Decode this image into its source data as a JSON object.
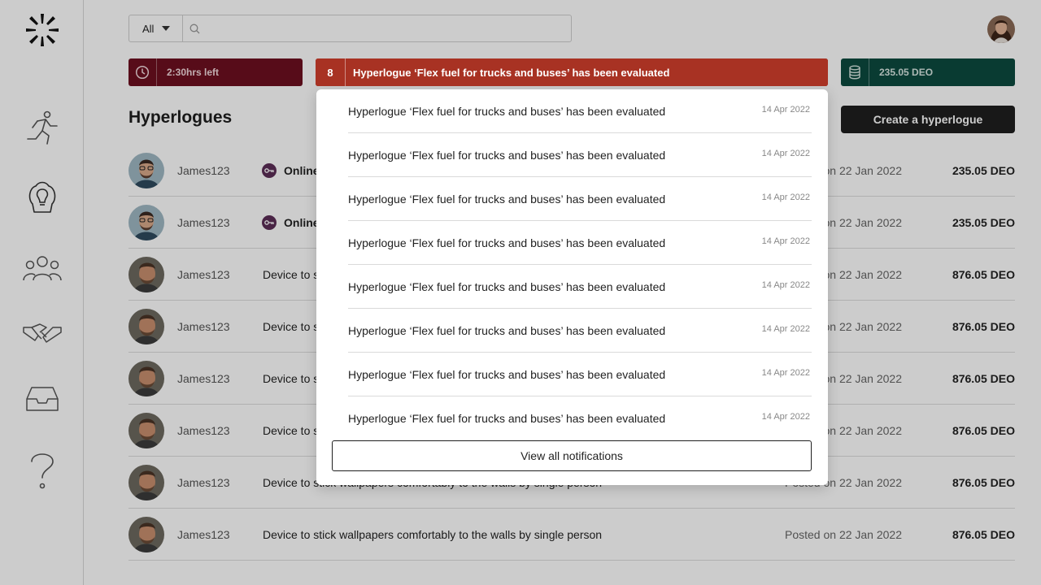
{
  "search": {
    "filter_value": "All",
    "placeholder": ""
  },
  "timer": {
    "label": "2:30hrs left"
  },
  "notification_bar": {
    "count": "8",
    "text": "Hyperlogue ‘Flex fuel for trucks and buses’ has been evaluated"
  },
  "balance": {
    "label": "235.05 DEO"
  },
  "page": {
    "title": "Hyperlogues",
    "create_button": "Create a hyperlogue"
  },
  "rows": [
    {
      "user": "James123",
      "title": "Online",
      "date": "Posted on 22 Jan 2022",
      "price": "235.05 DEO",
      "status_icon": "key-icon"
    },
    {
      "user": "James123",
      "title": "Online",
      "date": "Posted on 22 Jan 2022",
      "price": "235.05 DEO",
      "status_icon": "key-icon"
    },
    {
      "user": "James123",
      "title": "Device to stick wallpapers comfortably to the walls by single person",
      "date": "Posted on 22 Jan 2022",
      "price": "876.05 DEO"
    },
    {
      "user": "James123",
      "title": "Device to stick wallpapers comfortably to the walls by single person",
      "date": "Posted on 22 Jan 2022",
      "price": "876.05 DEO"
    },
    {
      "user": "James123",
      "title": "Device to stick wallpapers comfortably to the walls by single person",
      "date": "Posted on 22 Jan 2022",
      "price": "876.05 DEO"
    },
    {
      "user": "James123",
      "title": "Device to stick wallpapers comfortably to the walls by single person",
      "date": "Posted on 22 Jan 2022",
      "price": "876.05 DEO"
    },
    {
      "user": "James123",
      "title": "Device to stick wallpapers comfortably to the walls by single person",
      "date": "Posted on 22 Jan 2022",
      "price": "876.05 DEO"
    },
    {
      "user": "James123",
      "title": "Device to stick wallpapers comfortably to the walls by single person",
      "date": "Posted on 22 Jan 2022",
      "price": "876.05 DEO"
    }
  ],
  "notifications": [
    {
      "text": "Hyperlogue ‘Flex fuel for trucks and buses’ has been evaluated",
      "date": "14 Apr 2022"
    },
    {
      "text": "Hyperlogue ‘Flex fuel for trucks and buses’ has been evaluated",
      "date": "14 Apr 2022"
    },
    {
      "text": "Hyperlogue ‘Flex fuel for trucks and buses’ has been evaluated",
      "date": "14 Apr 2022"
    },
    {
      "text": "Hyperlogue ‘Flex fuel for trucks and buses’ has been evaluated",
      "date": "14 Apr 2022"
    },
    {
      "text": "Hyperlogue ‘Flex fuel for trucks and buses’ has been evaluated",
      "date": "14 Apr 2022"
    },
    {
      "text": "Hyperlogue ‘Flex fuel for trucks and buses’ has been evaluated",
      "date": "14 Apr 2022"
    },
    {
      "text": "Hyperlogue ‘Flex fuel for trucks and buses’ has been evaluated",
      "date": "14 Apr 2022"
    },
    {
      "text": "Hyperlogue ‘Flex fuel for trucks and buses’ has been evaluated",
      "date": "14 Apr 2022"
    }
  ],
  "view_all_label": "View all notifications",
  "sidebar": {
    "icons": [
      "logo-icon",
      "runner-icon",
      "idea-head-icon",
      "people-icon",
      "handshake-icon",
      "inbox-icon",
      "help-icon"
    ]
  },
  "colors": {
    "timer_bg": "#6d1020",
    "notification_bg": "#a83223",
    "balance_bg": "#0c4a3f",
    "primary_button": "#1f1f1f",
    "status_key": "#5c2d57"
  }
}
